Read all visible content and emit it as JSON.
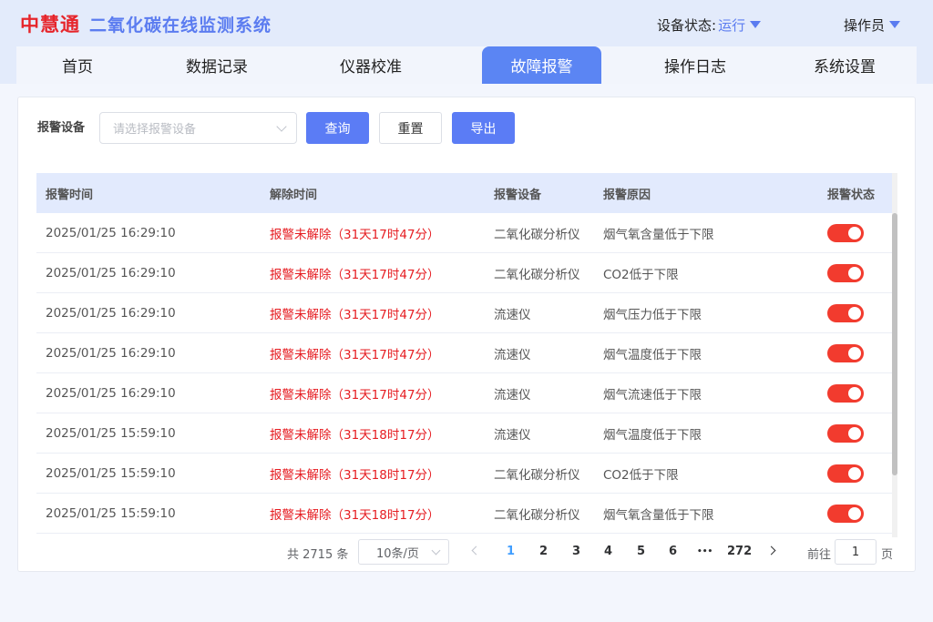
{
  "header": {
    "brand": "中慧通",
    "system_title": "二氧化碳在线监测系统",
    "device_status_label": "设备状态:",
    "device_status_value": "运行",
    "user": "操作员"
  },
  "nav": {
    "tabs": [
      {
        "label": "首页",
        "active": false
      },
      {
        "label": "数据记录",
        "active": false
      },
      {
        "label": "仪器校准",
        "active": false
      },
      {
        "label": "故障报警",
        "active": true
      },
      {
        "label": "操作日志",
        "active": false
      },
      {
        "label": "系统设置",
        "active": false
      }
    ]
  },
  "filter": {
    "label": "报警设备",
    "placeholder": "请选择报警设备",
    "query_button": "查询",
    "reset_button": "重置",
    "export_button": "导出"
  },
  "table": {
    "columns": [
      "报警时间",
      "解除时间",
      "报警设备",
      "报警原因",
      "报警状态"
    ],
    "rows": [
      {
        "time": "2025/01/25 16:29:10",
        "clear": "报警未解除（31天17时47分）",
        "device": "二氧化碳分析仪",
        "reason": "烟气氧含量低于下限",
        "on": true
      },
      {
        "time": "2025/01/25 16:29:10",
        "clear": "报警未解除（31天17时47分）",
        "device": "二氧化碳分析仪",
        "reason": "CO2低于下限",
        "on": true
      },
      {
        "time": "2025/01/25 16:29:10",
        "clear": "报警未解除（31天17时47分）",
        "device": "流速仪",
        "reason": "烟气压力低于下限",
        "on": true
      },
      {
        "time": "2025/01/25 16:29:10",
        "clear": "报警未解除（31天17时47分）",
        "device": "流速仪",
        "reason": "烟气温度低于下限",
        "on": true
      },
      {
        "time": "2025/01/25 16:29:10",
        "clear": "报警未解除（31天17时47分）",
        "device": "流速仪",
        "reason": "烟气流速低于下限",
        "on": true
      },
      {
        "time": "2025/01/25 15:59:10",
        "clear": "报警未解除（31天18时17分）",
        "device": "流速仪",
        "reason": "烟气温度低于下限",
        "on": true
      },
      {
        "time": "2025/01/25 15:59:10",
        "clear": "报警未解除（31天18时17分）",
        "device": "二氧化碳分析仪",
        "reason": "CO2低于下限",
        "on": true
      },
      {
        "time": "2025/01/25 15:59:10",
        "clear": "报警未解除（31天18时17分）",
        "device": "二氧化碳分析仪",
        "reason": "烟气氧含量低于下限",
        "on": true
      }
    ]
  },
  "pagination": {
    "total_text": "共 2715 条",
    "page_size": "10条/页",
    "pages": [
      "1",
      "2",
      "3",
      "4",
      "5",
      "6",
      "•••",
      "272"
    ],
    "current": "1",
    "goto_label": "前往",
    "goto_value": "1",
    "goto_unit": "页"
  },
  "colors": {
    "brand": "#e6252b",
    "accent": "#5b7cf0",
    "alarm": "#e61d22",
    "toggle_on": "#f23b2e"
  }
}
